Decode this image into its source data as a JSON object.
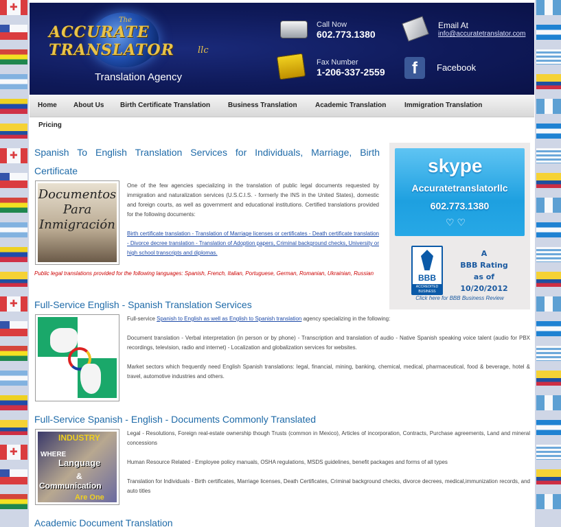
{
  "header": {
    "logo_the": "The",
    "logo_name": "ACCURATE TRANSLATOR",
    "logo_llc": "llc",
    "tagline": "Translation Agency",
    "call_label": "Call Now",
    "call_number": "602.773.1380",
    "fax_label": "Fax Number",
    "fax_number": "1-206-337-2559",
    "email_label": "Email At",
    "email_address": "info@accuratetranslator.com",
    "facebook_label": "Facebook"
  },
  "nav": {
    "items": [
      "Home",
      "About Us",
      "Birth Certificate Translation",
      "Business Translation",
      "Academic Translation",
      "Immigration Translation"
    ],
    "second_row": "Pricing"
  },
  "sections": [
    {
      "title": "Spanish To English Translation Services for Individuals, Marriage, Birth Certificate",
      "image_caption": "Documentos Para Inmigración",
      "text": "One of the few agencies specializing in the translation of public legal documents requested by immigration and naturalization services (U.S.C.I.S. - formerly the INS in the United States), domestic and foreign courts, as well as government and educational institutions. Certified translations provided for the following documents:",
      "links": "Birth certificate translation - Translation of Marriage licenses or certificates - Death certificate translation - Divorce decree translation - Translation of Adoption papers, Criminal background checks, University or high school transcripts and diplomas.",
      "note": "Public legal translations provided for the following languages: Spanish, French, Italian, Portuguese, German, Romanian, Ukrainian, Russian"
    },
    {
      "title": "Full-Service English - Spanish Translation Services",
      "text_prefix": "Full-service",
      "text_link": "Spanish to English as well as English to Spanish translation",
      "text_suffix": "agency specializing in the following:",
      "para2": "Document translation - Verbal interpretation (in person or by phone) - Transcription and translation of audio - Native Spanish speaking voice talent (audio for PBX recordings, television, radio and internet) - Localization and globalization services for websites.",
      "para3": "Market sectors which frequently need English Spanish translations: legal, financial, mining, banking, chemical, medical, pharmaceutical, food & beverage, hotel & travel, automotive industries and others."
    },
    {
      "title": "Full-Service Spanish - English - Documents Commonly Translated",
      "image_lines": [
        "INDUSTRY",
        "WHERE",
        "Language",
        "&",
        "Communication",
        "Are One"
      ],
      "para1": "Legal - Resolutions, Foreign real-estate ownership though Trusts (common in Mexico), Articles of incorporation, Contracts, Purchase agreements, Land and mineral concessions",
      "para2": "Human Resource Related - Employee policy manuals, OSHA regulations, MSDS guidelines, benefit packages and forms of all types",
      "para3": "Translation for Individuals - Birth certificates, Marriage licenses, Death Certificates, Criminal background checks, divorce decrees, medical,immunization records, and auto titles"
    },
    {
      "title": "Academic Document Translation"
    }
  ],
  "sidebar": {
    "skype_logo": "skype",
    "skype_user": "Accuratetranslatorllc",
    "skype_phone": "602.773.1380",
    "bbb_seal": "BBB",
    "bbb_seal_sub": "ACCREDITED BUSINESS",
    "bbb_rating": [
      "A",
      "BBB Rating",
      "as of",
      "10/20/2012"
    ],
    "bbb_caption": "Click here for BBB Business Review"
  },
  "colors": {
    "header_bg": "#0f1a5a",
    "heading": "#1e6aa8",
    "link": "#1d4aa8",
    "note_red": "#cc0000",
    "skype_blue": "#1ea0e0",
    "bbb_blue": "#0b5aa8"
  }
}
